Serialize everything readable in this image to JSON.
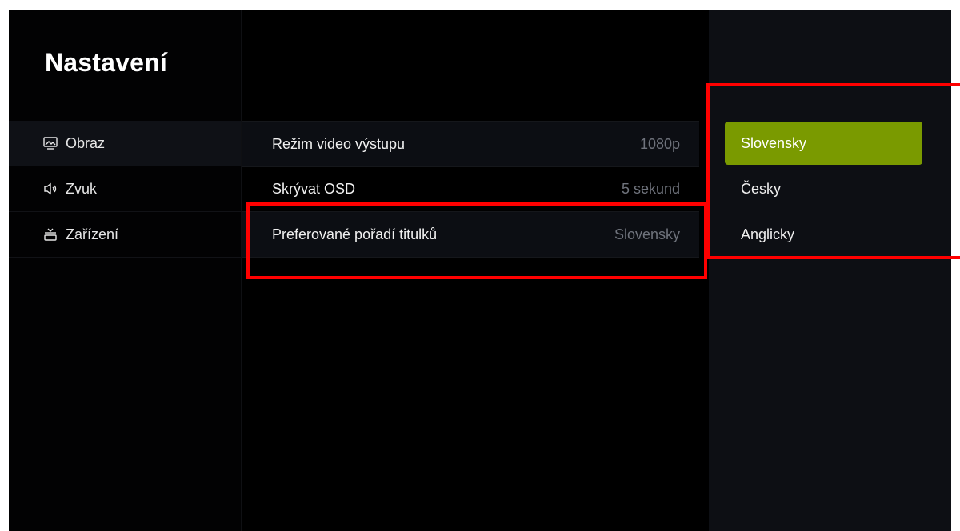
{
  "header": {
    "title": "Nastavení"
  },
  "sidebar": {
    "items": [
      {
        "label": "Obraz",
        "icon": "display-icon",
        "active": true
      },
      {
        "label": "Zvuk",
        "icon": "speaker-icon",
        "active": false
      },
      {
        "label": "Zařízení",
        "icon": "device-icon",
        "active": false
      }
    ]
  },
  "main": {
    "rows": [
      {
        "label": "Režim video výstupu",
        "value": "1080p"
      },
      {
        "label": "Skrývat OSD",
        "value": "5 sekund"
      },
      {
        "label": "Preferované pořadí titulků",
        "value": "Slovensky"
      }
    ]
  },
  "options": {
    "items": [
      {
        "label": "Slovensky",
        "selected": true
      },
      {
        "label": "Česky",
        "selected": false
      },
      {
        "label": "Anglicky",
        "selected": false
      }
    ]
  },
  "colors": {
    "accent": "#7a9a00",
    "annotation": "#ff0000",
    "background": "#000000",
    "panel": "#0d0f14"
  }
}
